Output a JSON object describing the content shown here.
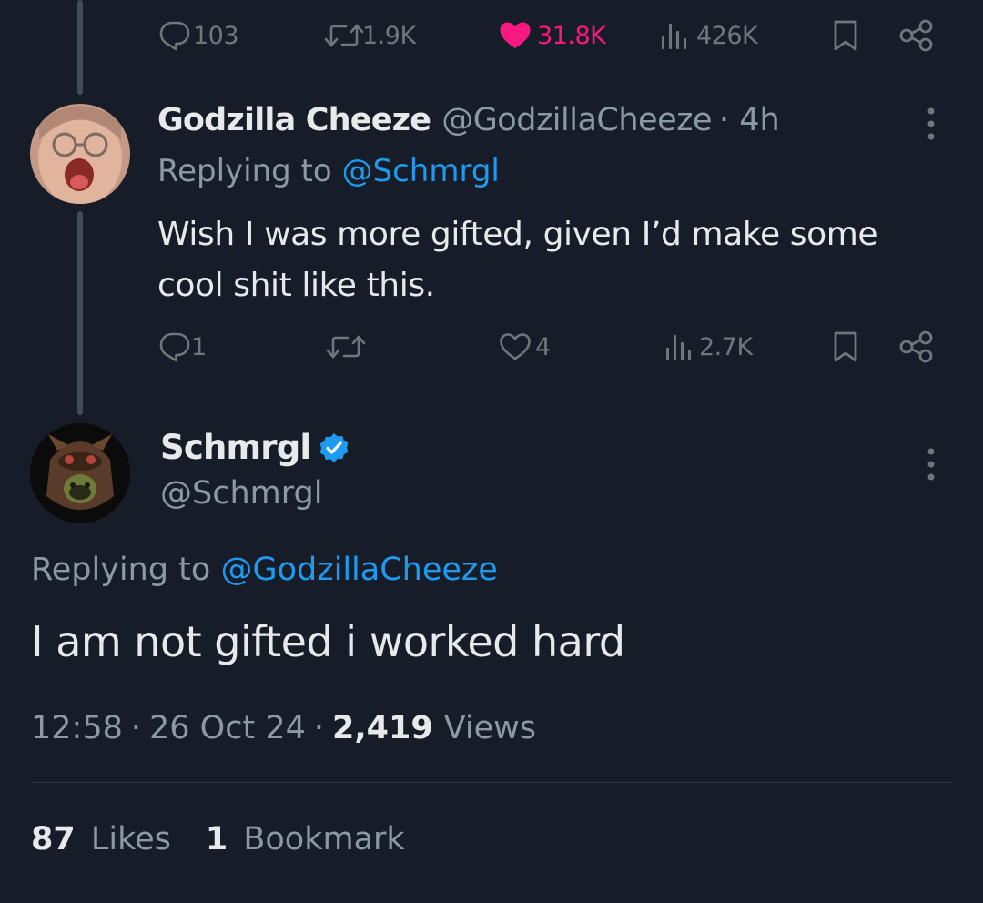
{
  "top_tweet_actions": {
    "replies": "103",
    "retweets": "1.9K",
    "likes": "31.8K",
    "views": "426K"
  },
  "reply_tweet": {
    "display_name": "Godzilla Cheeze",
    "handle": "@GodzillaCheeze",
    "time": "· 4h",
    "replying_prefix": "Replying to",
    "replying_handle": "@Schmrgl",
    "text_line1": "Wish I was more gifted, given I’d make some",
    "text_line2": "cool shit like this.",
    "actions": {
      "replies": "1",
      "likes": "4",
      "views": "2.7K"
    }
  },
  "main_tweet": {
    "display_name": "Schmrgl",
    "handle": "@Schmrgl",
    "replying_prefix": "Replying to",
    "replying_handle": "@GodzillaCheeze",
    "text": "I am not gifted i worked hard",
    "time": "12:58",
    "date": "26 Oct 24",
    "views_count": "2,419",
    "views_label": "Views",
    "sep": "·"
  },
  "engagement": {
    "likes_count": "87",
    "likes_label": "Likes",
    "bookmarks_count": "1",
    "bookmarks_label": "Bookmark"
  },
  "colors": {
    "background": "#161d28",
    "like_active": "#f91880",
    "link": "#1d9bf0",
    "verified": "#1d9bf0",
    "muted": "#8b98a5"
  }
}
